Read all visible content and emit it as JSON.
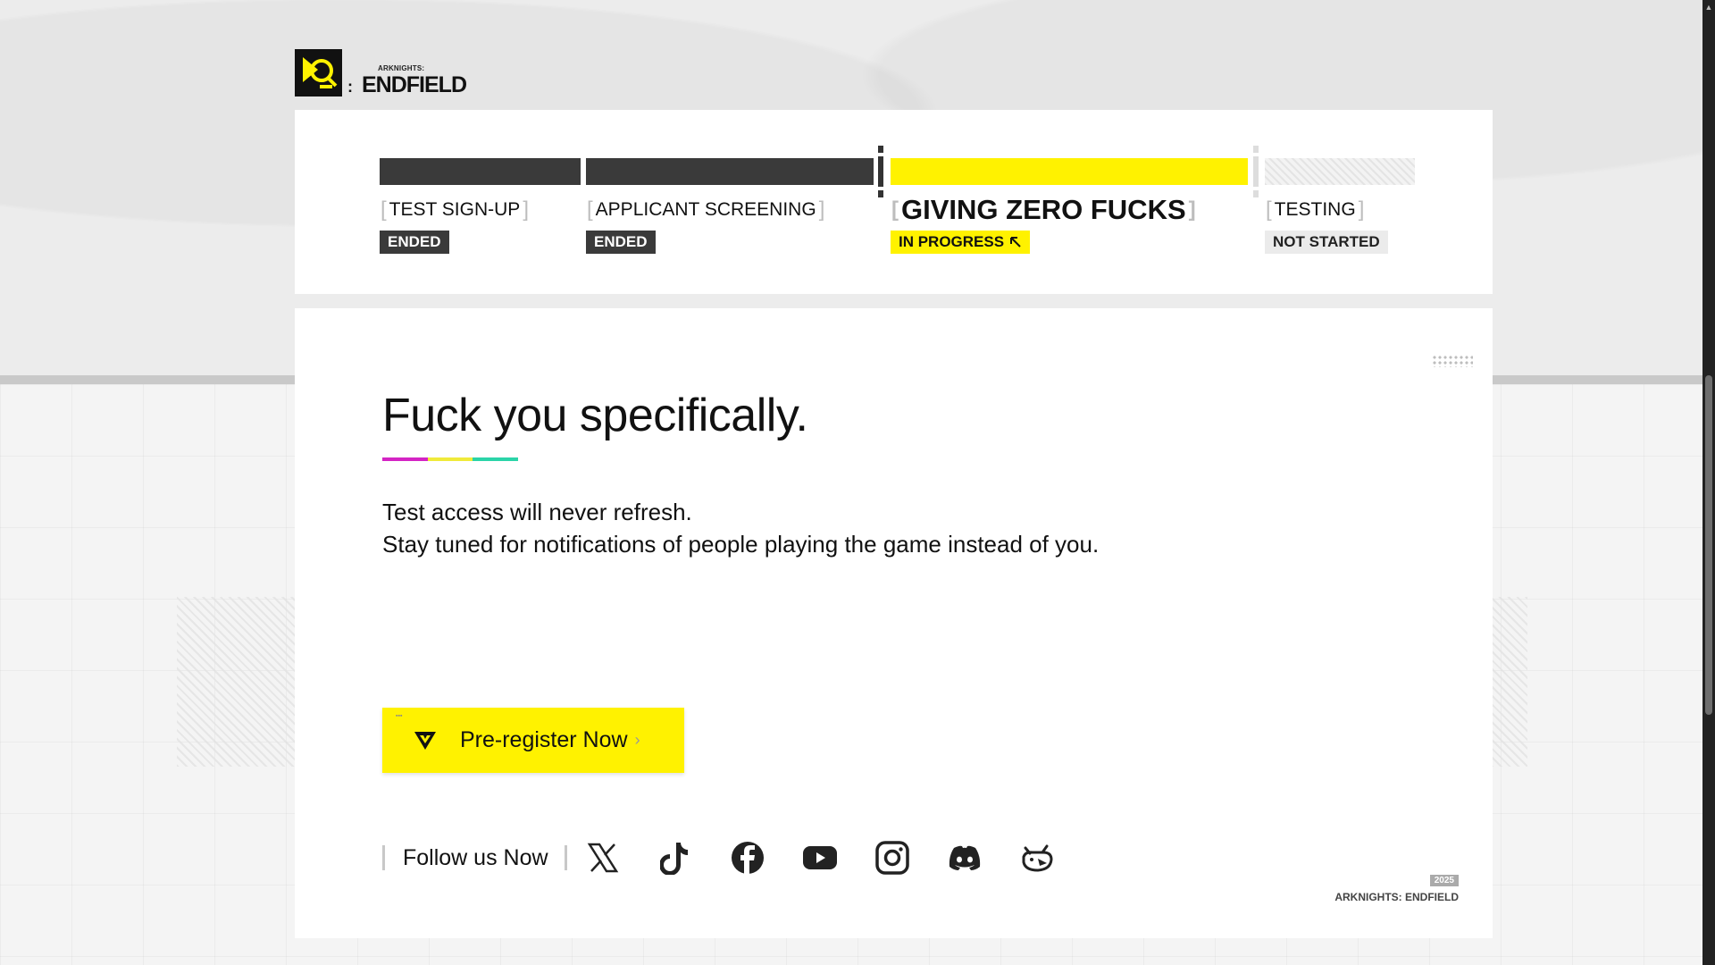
{
  "logo": {
    "small_text": "ARKNIGHTS:",
    "big_text": "ENDFIELD",
    "colon": ":"
  },
  "progress": {
    "stages": [
      {
        "title": "TEST SIGN-UP",
        "status": "ENDED"
      },
      {
        "title": "APPLICANT SCREENING",
        "status": "ENDED"
      },
      {
        "title": "GIVING ZERO FUCKS",
        "status": "IN PROGRESS"
      },
      {
        "title": "TESTING",
        "status": "NOT STARTED"
      }
    ],
    "bracket_open": "[",
    "bracket_close": "]"
  },
  "main": {
    "headline": "Fuck you specifically.",
    "lines": [
      "Test access will never refresh.",
      "Stay tuned for notifications of people playing the game instead of you."
    ],
    "prereg_label": "Pre-register Now",
    "follow_label": "Follow us Now",
    "social": [
      "x-icon",
      "tiktok-icon",
      "facebook-icon",
      "youtube-icon",
      "instagram-icon",
      "discord-icon",
      "bilibili-icon"
    ],
    "copyright_year": "2025",
    "copyright_name": "ARKNIGHTS: ENDFIELD"
  },
  "colors": {
    "accent_yellow": "#fff200",
    "ended_dark": "#3a3a3a",
    "underline": [
      "#d424c4",
      "#f0ea3a",
      "#2bd4a8"
    ]
  }
}
